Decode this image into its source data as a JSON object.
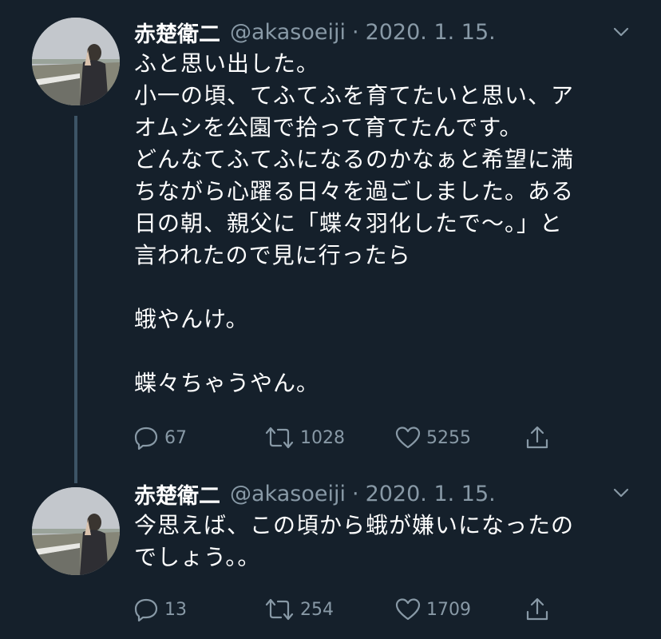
{
  "tweets": [
    {
      "author": "赤楚衛二",
      "handle": "@akasoeiji",
      "separator": "·",
      "date": "2020. 1. 15.",
      "text": "ふと思い出した。\n小一の頃、てふてふを育てたいと思い、ア\nオムシを公園で拾って育てたんです。\nどんなてふてふになるのかなぁと希望に満\nちながら心躍る日々を過ごしました。ある\n日の朝、親父に「蝶々羽化したで〜。」と\n言われたので見に行ったら\n\n蛾やんけ。\n\n蝶々ちゃうやん。",
      "replies": "67",
      "retweets": "1028",
      "likes": "5255",
      "icons": {
        "reply": "reply-icon",
        "retweet": "retweet-icon",
        "like": "heart-icon",
        "share": "share-icon",
        "menu": "chevron-down-icon"
      }
    },
    {
      "author": "赤楚衛二",
      "handle": "@akasoeiji",
      "separator": "·",
      "date": "2020. 1. 15.",
      "text": "今思えば、この頃から蛾が嫌いになったの\nでしょう。。",
      "replies": "13",
      "retweets": "254",
      "likes": "1709",
      "icons": {
        "reply": "reply-icon",
        "retweet": "retweet-icon",
        "like": "heart-icon",
        "share": "share-icon",
        "menu": "chevron-down-icon"
      }
    }
  ],
  "colors": {
    "background": "#15202b",
    "text_primary": "#ffffff",
    "text_secondary": "#8899a6",
    "thread_line": "#3d5466"
  }
}
